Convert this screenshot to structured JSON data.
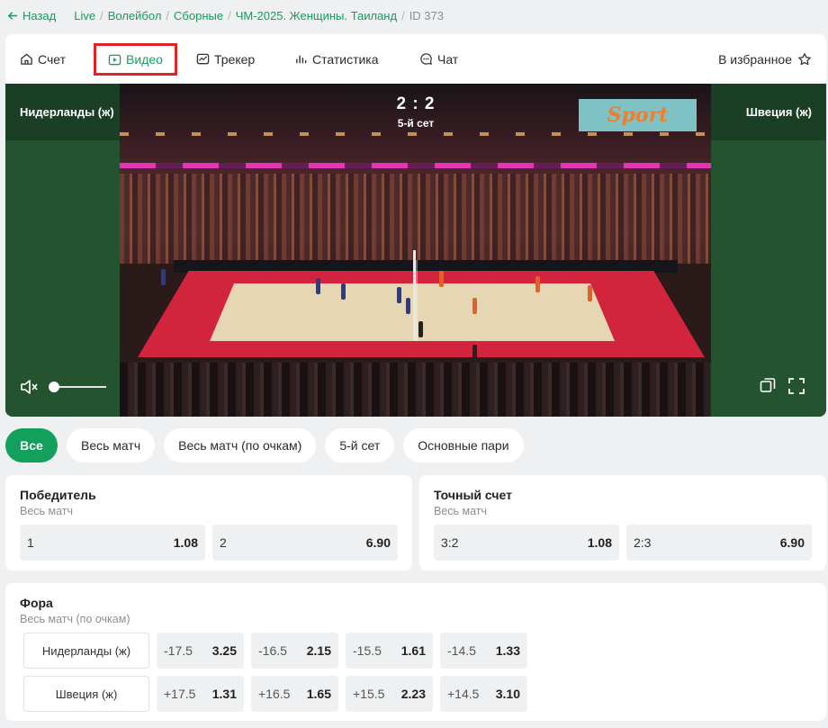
{
  "breadcrumb": {
    "back": "Назад",
    "items": [
      "Live",
      "Волейбол",
      "Сборные",
      "ЧМ-2025. Женщины. Таиланд"
    ],
    "current": "ID 373"
  },
  "tabs": [
    {
      "label": "Счет",
      "icon": "home-icon"
    },
    {
      "label": "Видео",
      "icon": "play-icon",
      "active": true
    },
    {
      "label": "Трекер",
      "icon": "tracker-icon"
    },
    {
      "label": "Статистика",
      "icon": "stats-icon"
    },
    {
      "label": "Чат",
      "icon": "chat-icon"
    }
  ],
  "favorites": {
    "label": "В избранное",
    "icon": "star-icon"
  },
  "video": {
    "home_team": "Нидерланды (ж)",
    "away_team": "Швеция (ж)",
    "score": "2 : 2",
    "set": "5-й сет",
    "logo_text": "Sport",
    "volume": 0
  },
  "filters": [
    "Все",
    "Весь матч",
    "Весь матч (по очкам)",
    "5-й сет",
    "Основные пари"
  ],
  "markets": {
    "winner": {
      "title": "Победитель",
      "subtitle": "Весь матч",
      "odds": [
        {
          "label": "1",
          "value": "1.08"
        },
        {
          "label": "2",
          "value": "6.90"
        }
      ]
    },
    "exact_score": {
      "title": "Точный счет",
      "subtitle": "Весь матч",
      "odds": [
        {
          "label": "3:2",
          "value": "1.08"
        },
        {
          "label": "2:3",
          "value": "6.90"
        }
      ]
    },
    "handicap": {
      "title": "Фора",
      "subtitle": "Весь матч (по очкам)",
      "rows": [
        {
          "team": "Нидерланды (ж)",
          "odds": [
            {
              "line": "-17.5",
              "value": "3.25"
            },
            {
              "line": "-16.5",
              "value": "2.15"
            },
            {
              "line": "-15.5",
              "value": "1.61"
            },
            {
              "line": "-14.5",
              "value": "1.33"
            }
          ]
        },
        {
          "team": "Швеция (ж)",
          "odds": [
            {
              "line": "+17.5",
              "value": "1.31"
            },
            {
              "line": "+16.5",
              "value": "1.65"
            },
            {
              "line": "+15.5",
              "value": "2.23"
            },
            {
              "line": "+14.5",
              "value": "3.10"
            }
          ]
        }
      ]
    }
  },
  "colors": {
    "accent": "#12a05c",
    "highlight": "#e02424"
  }
}
